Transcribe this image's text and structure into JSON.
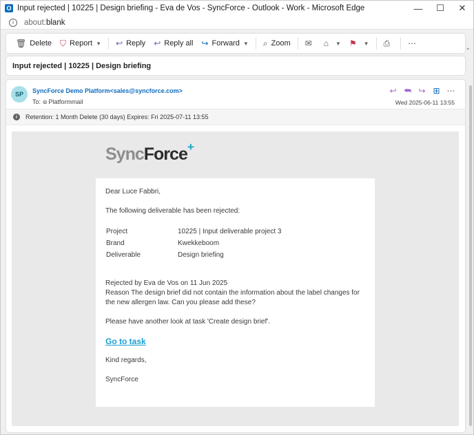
{
  "window": {
    "title": "Input rejected | 10225 | Design briefing - Eva de Vos - SyncForce - Outlook - Work - Microsoft Edge",
    "app_icon": "O",
    "controls": [
      "—",
      "☐",
      "✕"
    ]
  },
  "address": {
    "scheme": "about:",
    "host": "blank"
  },
  "toolbar": {
    "delete": "Delete",
    "report": "Report",
    "reply": "Reply",
    "reply_all": "Reply all",
    "forward": "Forward",
    "zoom": "Zoom"
  },
  "subject": "Input rejected | 10225 | Design briefing",
  "message": {
    "avatar": "SP",
    "from": "SyncForce Demo Platform<sales@syncforce.com>",
    "to_label": "To:",
    "to_name": "Platformmail",
    "date": "Wed 2025-06-11 13:55",
    "retention": "Retention: 1 Month Delete (30 days) Expires: Fri 2025-07-11 13:55"
  },
  "email": {
    "logo_sync": "Sync",
    "logo_force": "Force",
    "logo_plus": "+",
    "greeting": "Dear Luce Fabbri,",
    "intro": "The following deliverable has been rejected:",
    "details": [
      {
        "key": "Project",
        "value": "10225 | Input deliverable project 3"
      },
      {
        "key": "Brand",
        "value": "Kwekkeboom"
      },
      {
        "key": "Deliverable",
        "value": "Design briefing"
      }
    ],
    "rejected_by": "Rejected by Eva de Vos on 11 Jun 2025",
    "reason": "Reason The design brief did not contain the information about the label changes for the new allergen law. Can you please add these?",
    "request": "Please have another look at task 'Create design brief'.",
    "link": "Go to task",
    "closing": "Kind regards,",
    "signature": "SyncForce"
  },
  "colors": {
    "accent": "#0f6cbd",
    "link": "#1a9fd0",
    "brand_plus": "#1aa6c9",
    "avatar_bg": "#a8dfe8"
  }
}
